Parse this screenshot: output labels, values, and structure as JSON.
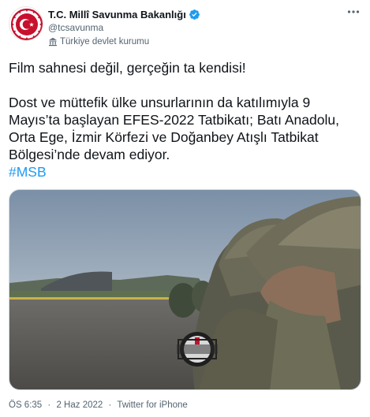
{
  "account": {
    "display_name": "T.C. Millî Savunma Bakanlığı",
    "handle": "@tcsavunma",
    "label": "Türkiye devlet kurumu",
    "avatar_icon": "msb-emblem-icon",
    "verified_icon": "verified-badge-icon",
    "verified_color": "#1d9bf0"
  },
  "tweet": {
    "line1": "Film sahnesi değil, gerçeğin ta kendisi!",
    "paragraph2": "Dost ve müttefik ülke unsurlarının da katılımıyla 9 Mayıs’ta başlayan EFES-2022 Tatbikatı; Batı Anadolu, Orta Ege, İzmir Körfezi ve Doğanbey Atışlı Tatbikat Bölgesi’nde devam ediyor.",
    "hashtag": "#MSB",
    "hashtag_color": "#1d9bf0"
  },
  "media": {
    "type": "video-still",
    "scene": "soldiers-in-helmets-on-airfield"
  },
  "footer": {
    "time": "ÖS 6:35",
    "separator1": "·",
    "date": "2 Haz 2022",
    "separator2": "·",
    "source": "Twitter for iPhone"
  },
  "colors": {
    "text": "#0f1419",
    "secondary": "#536471",
    "accent": "#1d9bf0",
    "emblem_red": "#c8102e"
  }
}
